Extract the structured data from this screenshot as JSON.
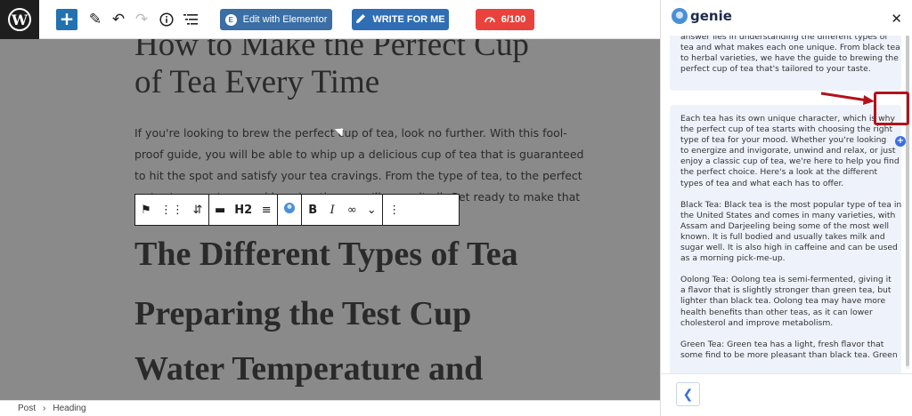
{
  "toolbar": {
    "wp_logo": "W",
    "add_icon": "+",
    "elementor_badge": "E",
    "elementor_label": "Edit with Elementor",
    "write_label": "WRITE FOR ME",
    "score_label": "6/100"
  },
  "editor": {
    "title_line1": "How to Make the Perfect Cup",
    "title_line2": "of Tea Every Time",
    "paragraph_lines": [
      "If you're looking to brew the perfect cup of tea, look no further. With this fool-",
      "proof guide, you will be able to whip up a delicious cup of tea that is guaranteed",
      "to hit the spot and satisfy your tea cravings. From the type of tea, to the perfect",
      "water temperature, and brewing time - we'll cover it all. Get ready to make that"
    ],
    "block_toolbar": {
      "heading_level": "H2",
      "bold": "B",
      "italic": "I"
    },
    "headings": [
      "The Different Types of Tea",
      "Preparing the Test Cup",
      "Water Temperature and"
    ]
  },
  "statusbar": {
    "crumb1": "Post",
    "crumb2": "Heading"
  },
  "genie": {
    "brand": "genie",
    "card1_lines": [
      "answer lies in understanding the different types of",
      "tea and what makes each one unique. From black tea",
      "to herbal varieties, we have the guide to brewing the",
      "perfect cup of tea that's tailored to your taste."
    ],
    "card2_para1": [
      "Each tea has its own unique character, which is why",
      "the perfect cup of tea starts with choosing the right",
      "type of tea for your mood. Whether you're looking",
      "to energize and invigorate, unwind and relax, or just",
      "enjoy a classic cup of tea, we're here to help you find",
      "the perfect choice. Here's a look at the different",
      "types of tea and what each has to offer."
    ],
    "card2_para2": [
      "Black Tea: Black tea is the most popular type of tea in",
      "the United States and comes in many varieties, with",
      "Assam and Darjeeling being some of the most well",
      "known. It is full bodied and usually takes milk and",
      "sugar well. It is also high in caffeine and can be used",
      "as a morning pick-me-up."
    ],
    "card2_para3": [
      "Oolong Tea: Oolong tea is semi-fermented, giving it",
      "a flavor that is slightly stronger than green tea, but",
      "lighter than black tea. Oolong tea may have more",
      "health benefits than other teas, as it can lower",
      "cholesterol and improve metabolism."
    ],
    "card2_para4": [
      "Green Tea: Green tea has a light, fresh flavor that",
      "some find to be more pleasant than black tea. Green"
    ]
  },
  "colors": {
    "primary_blue": "#2271b1",
    "score_red": "#e9423c",
    "annotation_red": "#b3121c",
    "card_bg": "#eef3fb"
  }
}
